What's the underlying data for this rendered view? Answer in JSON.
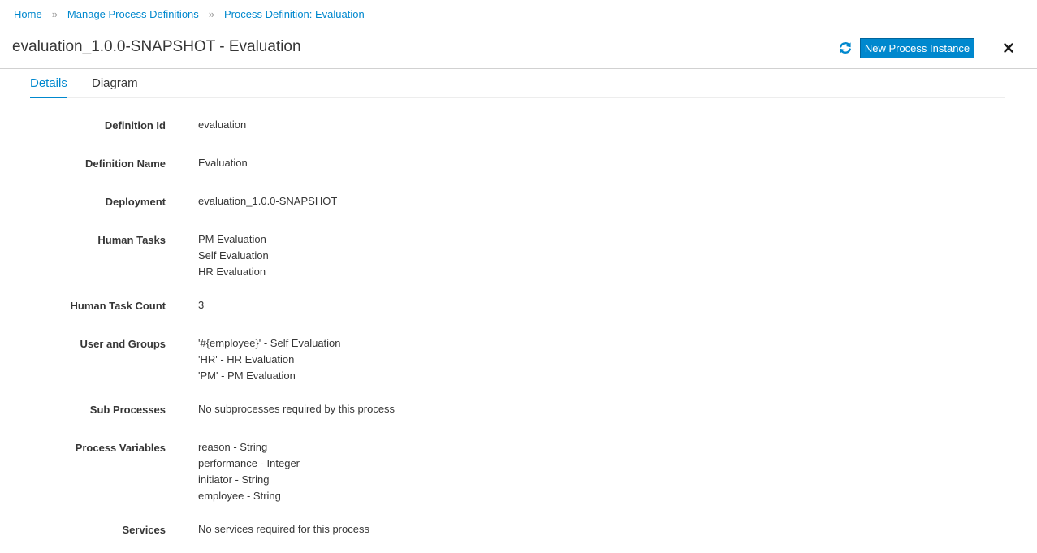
{
  "breadcrumb": {
    "items": [
      "Home",
      "Manage Process Definitions",
      "Process Definition: Evaluation"
    ],
    "separator": "»"
  },
  "header": {
    "title": "evaluation_1.0.0-SNAPSHOT - Evaluation",
    "new_instance_label": "New Process Instance",
    "refresh_icon": "refresh-icon",
    "close_icon": "close-icon"
  },
  "tabs": [
    {
      "label": "Details",
      "active": true
    },
    {
      "label": "Diagram",
      "active": false
    }
  ],
  "details": {
    "definition_id": {
      "label": "Definition Id",
      "values": [
        "evaluation"
      ]
    },
    "definition_name": {
      "label": "Definition Name",
      "values": [
        "Evaluation"
      ]
    },
    "deployment": {
      "label": "Deployment",
      "values": [
        "evaluation_1.0.0-SNAPSHOT"
      ]
    },
    "human_tasks": {
      "label": "Human Tasks",
      "values": [
        "PM Evaluation",
        "Self Evaluation",
        "HR Evaluation"
      ]
    },
    "human_task_count": {
      "label": "Human Task Count",
      "values": [
        "3"
      ]
    },
    "user_and_groups": {
      "label": "User and Groups",
      "values": [
        "'#{employee}' - Self Evaluation",
        "'HR' - HR Evaluation",
        "'PM' - PM Evaluation"
      ]
    },
    "sub_processes": {
      "label": "Sub Processes",
      "values": [
        "No subprocesses required by this process"
      ]
    },
    "process_variables": {
      "label": "Process Variables",
      "values": [
        "reason - String",
        "performance - Integer",
        "initiator - String",
        "employee - String"
      ]
    },
    "services": {
      "label": "Services",
      "values": [
        "No services required for this process"
      ]
    }
  },
  "colors": {
    "accent": "#0088ce",
    "text": "#363636",
    "border": "#d1d1d1"
  }
}
